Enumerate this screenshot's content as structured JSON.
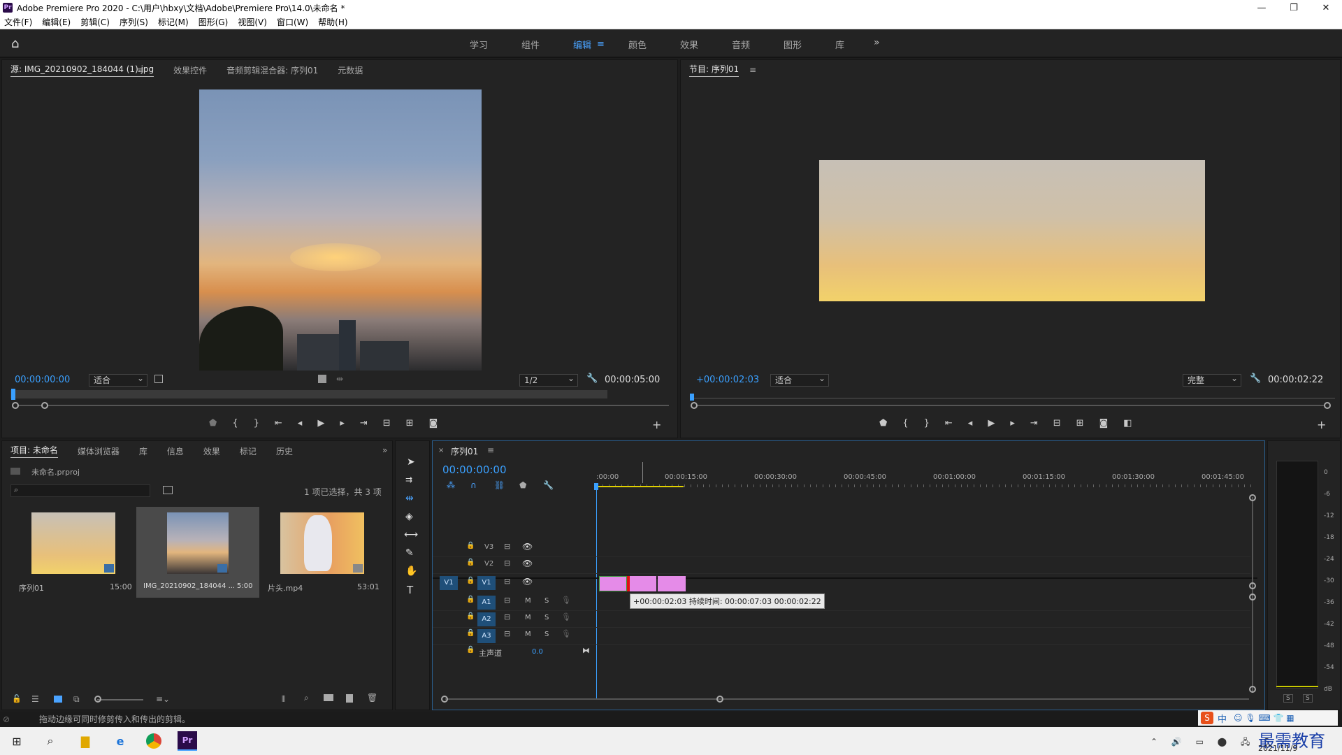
{
  "titlebar": {
    "title": "Adobe Premiere Pro 2020 - C:\\用户\\hbxy\\文档\\Adobe\\Premiere Pro\\14.0\\未命名 *",
    "logo": "Pr"
  },
  "menu": [
    "文件(F)",
    "编辑(E)",
    "剪辑(C)",
    "序列(S)",
    "标记(M)",
    "图形(G)",
    "视图(V)",
    "窗口(W)",
    "帮助(H)"
  ],
  "workspace_tabs": [
    "学习",
    "组件",
    "编辑",
    "颜色",
    "效果",
    "音频",
    "图形",
    "库"
  ],
  "workspace_active": "编辑",
  "source": {
    "tabs": [
      "源: IMG_20210902_184044 (1).jpg",
      "效果控件",
      "音频剪辑混合器: 序列01",
      "元数据"
    ],
    "timecode": "00:00:00:00",
    "fit": "适合",
    "resolution": "1/2",
    "duration": "00:00:05:00"
  },
  "program": {
    "tab": "节目: 序列01",
    "timecode": "+00:00:02:03",
    "fit": "适合",
    "quality": "完整",
    "duration": "00:00:02:22"
  },
  "project": {
    "tabs": [
      "项目: 未命名",
      "媒体浏览器",
      "库",
      "信息",
      "效果",
      "标记",
      "历史"
    ],
    "file": "未命名.prproj",
    "selection_info": "1 项已选择，共 3 项",
    "items": [
      {
        "name": "序列01",
        "duration": "15:00"
      },
      {
        "name": "IMG_20210902_184044 ...",
        "duration": "5:00"
      },
      {
        "name": "片头.mp4",
        "duration": "53:01"
      }
    ]
  },
  "timeline": {
    "tab": "序列01",
    "timecode": "00:00:00:00",
    "ruler": [
      ":00:00",
      "00:00:15:00",
      "00:00:30:00",
      "00:00:45:00",
      "00:01:00:00",
      "00:01:15:00",
      "00:01:30:00",
      "00:01:45:00"
    ],
    "tracks_video": [
      "V3",
      "V2",
      "V1"
    ],
    "tracks_audio": [
      "A1",
      "A2",
      "A3"
    ],
    "src_patch_v": "V1",
    "master": "主声道",
    "master_value": "0.0",
    "tooltip": "+00:00:02:03 持续时间: 00:00:07:03 00:00:02:22",
    "mute": "M",
    "solo": "S"
  },
  "meter": {
    "scale": [
      "0",
      "-6",
      "-12",
      "-18",
      "-24",
      "-30",
      "-36",
      "-42",
      "-48",
      "-54",
      "dB"
    ],
    "solo": [
      "S",
      "S"
    ]
  },
  "status": "拖动边缘可同时修剪传入和传出的剪辑。",
  "taskbar": {
    "date": "2021/11/9",
    "watermark": "最需教育",
    "ime": "中"
  },
  "colors": {
    "accent": "#3aa0ff",
    "clip": "#e58be8",
    "panel": "#232323"
  }
}
